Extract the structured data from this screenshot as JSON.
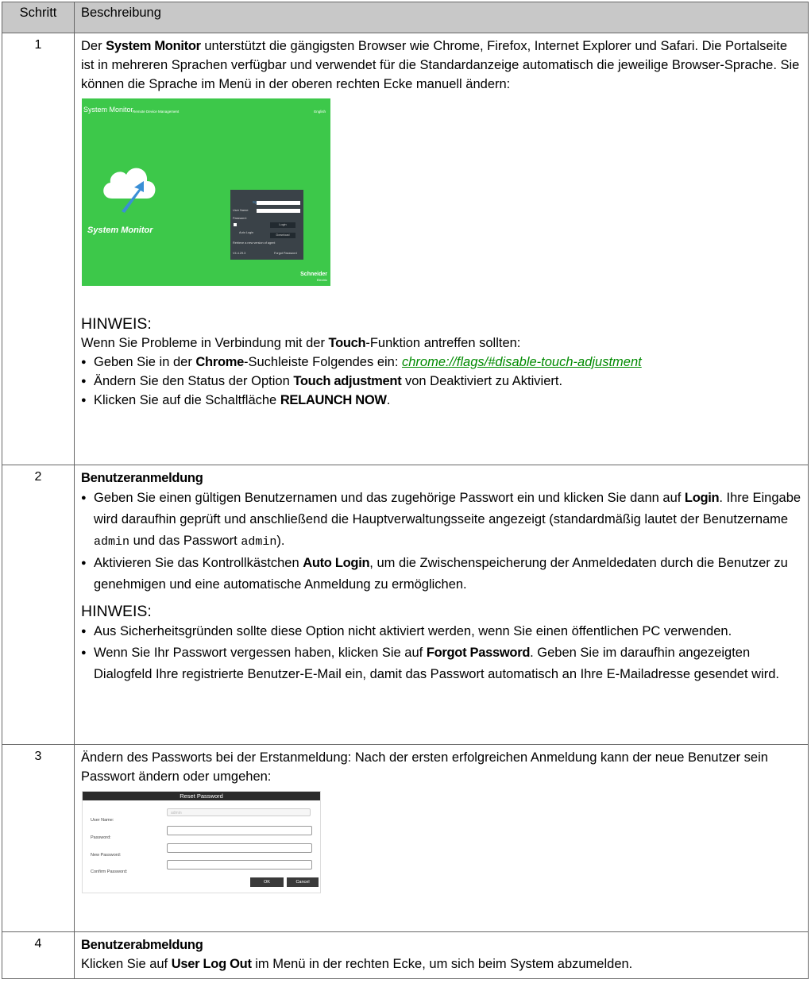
{
  "table": {
    "headers": {
      "step": "Schritt",
      "description": "Beschreibung"
    }
  },
  "row1": {
    "num": "1",
    "p1_a": "Der ",
    "p1_b": "System Monitor",
    "p1_c": " unterstützt die gängigsten Browser wie Chrome, Firefox, Internet Explorer und Safari. Die Portalseite ist in mehreren Sprachen verfügbar und verwendet für die Standardanzeige automatisch die jeweilige Browser-Sprache. Sie können die Sprache im Menü in der oberen rechten Ecke manuell ändern:",
    "screenshot": {
      "app_title": "System Monitor",
      "subtitle": "Remote Device Management",
      "language": "English",
      "logo_text": "System Monitor",
      "panel_title": "System Login",
      "user_label": "User Name:",
      "password_label": "Password:",
      "auto_login": "Auto Login",
      "login_btn": "Login",
      "restore_text": "Retrieve a new version of agent",
      "download_btn": "Download",
      "version": "V4.4.29.3",
      "forgot": "Forgot Password",
      "brand_1": "Schneider",
      "brand_2": "Electric"
    },
    "note_title": "HINWEIS:",
    "note_intro_a": "Wenn Sie Probleme in Verbindung mit der ",
    "note_intro_b": "Touch",
    "note_intro_c": "-Funktion antreffen sollten:",
    "b1_a": "Geben Sie in der ",
    "b1_b": "Chrome",
    "b1_c": "-Suchleiste Folgendes ein: ",
    "b1_link": "chrome://flags/#disable-touch-adjustment",
    "b2_a": "Ändern Sie den Status der Option ",
    "b2_b": "Touch adjustment",
    "b2_c": " von Deaktiviert zu Aktiviert.",
    "b3_a": "Klicken Sie auf die Schaltfläche ",
    "b3_b": "RELAUNCH NOW",
    "b3_c": "."
  },
  "row2": {
    "num": "2",
    "title": "Benutzeranmeldung",
    "b1_a": "Geben Sie einen gültigen Benutzernamen und das zugehörige Passwort ein und klicken Sie dann auf ",
    "b1_b": "Login",
    "b1_c": ". Ihre Eingabe wird daraufhin geprüft und anschließend die Hauptverwaltungsseite angezeigt (standardmäßig lautet der Benutzername ",
    "b1_code1": "admin",
    "b1_d": " und das Passwort ",
    "b1_code2": "admin",
    "b1_e": ").",
    "b2_a": "Aktivieren Sie das Kontrollkästchen ",
    "b2_b": "Auto Login",
    "b2_c": ", um die Zwischenspeicherung der Anmeldedaten durch die Benutzer zu genehmigen und eine automatische Anmeldung zu ermöglichen.",
    "note_title": "HINWEIS:",
    "n1": "Aus Sicherheitsgründen sollte diese Option nicht aktiviert werden, wenn Sie einen öffentlichen PC verwenden.",
    "n2_a": "Wenn Sie Ihr Passwort vergessen haben, klicken Sie auf ",
    "n2_b": "Forgot Password",
    "n2_c": ". Geben Sie im daraufhin angezeigten Dialogfeld Ihre registrierte Benutzer-E-Mail ein, damit das Passwort automatisch an Ihre E-Mailadresse gesendet wird."
  },
  "row3": {
    "num": "3",
    "text": "Ändern des Passworts bei der Erstanmeldung: Nach der ersten erfolgreichen Anmeldung kann der neue Benutzer sein Passwort ändern oder umgehen:",
    "screenshot": {
      "header": "Reset Password",
      "user_label": "User Name:",
      "user_value": "admin",
      "password_label": "Password:",
      "new_password_label": "New Password:",
      "confirm_label": "Confirm Password:",
      "ok": "OK",
      "cancel": "Cancel"
    }
  },
  "row4": {
    "num": "4",
    "title": "Benutzerabmeldung",
    "text_a": "Klicken Sie auf ",
    "text_b": "User Log Out",
    "text_c": " im Menü in der rechten Ecke, um sich beim System abzumelden."
  }
}
